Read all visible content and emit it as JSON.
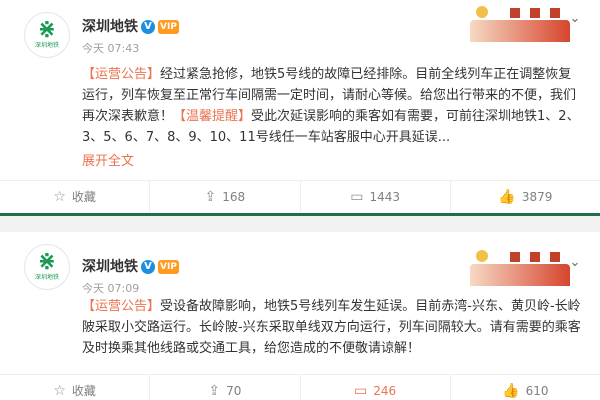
{
  "post1": {
    "avatar_text": "深圳地铁",
    "author": "深圳地铁",
    "verified_mark": "V",
    "vip_mark": "VIP",
    "time": "今天 07:43",
    "body": "【运营公告】经过紧急抢修，地铁5号线的故障已经排除。目前全线列车正在调整恢复运行，列车恢复至正常行车间隔需一定时间，请耐心等候。给您出行带来的不便，我们再次深表歉意！【温馨提醒】受此次延误影响的乘客如有需要，可前往深圳地铁1、2、3、5、6、7、8、9、10、11号线任一车站客服中心开具延误...",
    "expand_label": "展开全文",
    "actions": [
      {
        "icon": "star-icon",
        "glyph": "☆",
        "label": "收藏"
      },
      {
        "icon": "share-icon",
        "glyph": "⇪",
        "label": "168"
      },
      {
        "icon": "comment-icon",
        "glyph": "▭",
        "label": "1443"
      },
      {
        "icon": "like-icon",
        "glyph": "👍",
        "label": "3879"
      }
    ]
  },
  "post2": {
    "avatar_text": "深圳地铁",
    "author": "深圳地铁",
    "verified_mark": "V",
    "vip_mark": "VIP",
    "time": "今天 07:09",
    "body": "【运营公告】受设备故障影响，地铁5号线列车发生延误。目前赤湾-兴东、黄贝岭-长岭陂采取小交路运行。长岭陂-兴东采取单线双方向运行，列车间隔较大。请有需要的乘客及时换乘其他线路或交通工具，给您造成的不便敬请谅解！",
    "actions": [
      {
        "icon": "star-icon",
        "glyph": "☆",
        "label": "收藏"
      },
      {
        "icon": "share-icon",
        "glyph": "⇪",
        "label": "70"
      },
      {
        "icon": "comment-icon",
        "glyph": "▭",
        "label": "246"
      },
      {
        "icon": "like-icon",
        "glyph": "👍",
        "label": "610"
      }
    ]
  },
  "colors": {
    "accent": "#eb7350",
    "brand_green": "#1a9a52",
    "divider_green": "#1f6f4a"
  }
}
